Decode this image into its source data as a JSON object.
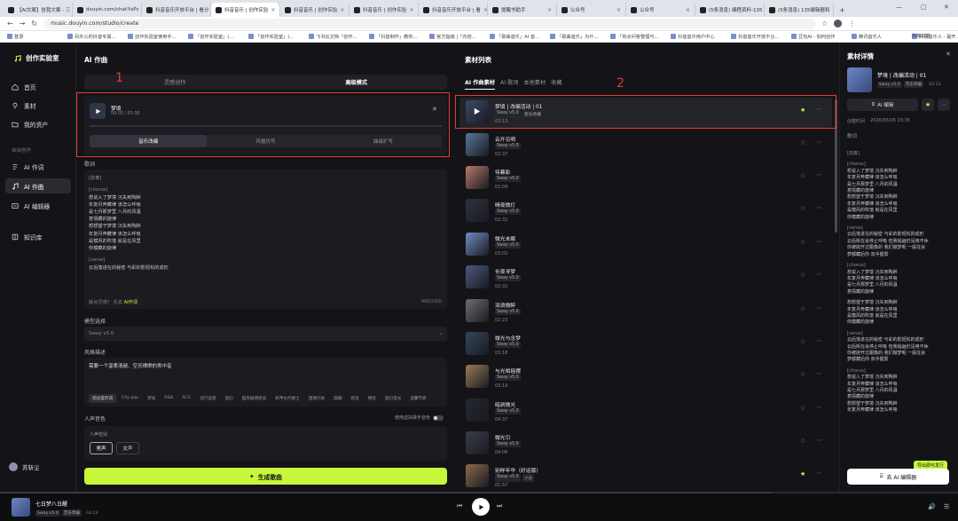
{
  "browser": {
    "tabs": [
      {
        "label": "【AI文案】告我文案 - 三",
        "active": false
      },
      {
        "label": "douyin.com/chat?isPc",
        "active": false
      },
      {
        "label": "抖音音乐开放平台 | 看分",
        "active": false
      },
      {
        "label": "抖音音乐 | 创作实验",
        "active": true
      },
      {
        "label": "抖音音乐 | 创作实验",
        "active": false
      },
      {
        "label": "抖音音乐 | 创作实验",
        "active": false
      },
      {
        "label": "抖音音乐开放平台 | 看",
        "active": false
      },
      {
        "label": "提醒书助手",
        "active": false
      },
      {
        "label": "公众号",
        "active": false
      },
      {
        "label": "公众号",
        "active": false
      },
      {
        "label": "(5条消息) 编程资料-135",
        "active": false
      },
      {
        "label": "(5条消息) 135编辑器和",
        "active": false
      }
    ],
    "url": "music.douyin.com/studio/create",
    "bookmarks": [
      "登录",
      "另外公的抖音专属...",
      "创作实验室使用手...",
      "「创作实验室」(...",
      "「创作实验室」(...",
      "飞书云文档「创作...",
      "「抖音制作」教你...",
      "官方指南 |「内容...",
      "「歌曲音乐」AI 音...",
      "「歌曲音乐」为什...",
      "「热点问答整理与...",
      "抖音音乐用户中心",
      "抖音音乐开放平台...",
      "豆包AI - 如何创作",
      "腾讯音乐人",
      "网易音乐人 - 最开...",
      "百家号 - 下，你就知道"
    ],
    "all_bookmarks": "所有书签"
  },
  "sidebar": {
    "brand": "创作实验室",
    "items": [
      {
        "label": "首页"
      },
      {
        "label": "素材"
      },
      {
        "label": "我的资产"
      }
    ],
    "section_label": "自由创作",
    "create_items": [
      {
        "label": "AI 作词"
      },
      {
        "label": "AI 作曲"
      },
      {
        "label": "AI 编辑器"
      }
    ],
    "extra_item": "知识库",
    "user": "苏斩尘"
  },
  "compose": {
    "title": "AI 作曲",
    "modes": [
      "灵感创作",
      "高级模式"
    ],
    "ref_track": {
      "name": "梦境",
      "time": "00:00 / 03:38"
    },
    "ref_options": [
      "音乐改编",
      "风格仿写",
      "曲级扩写"
    ],
    "lyrics_label": "歌词",
    "lyrics_lines": [
      {
        "text": "[前奏]",
        "tag": true
      },
      {
        "text": "",
        "tag": false
      },
      {
        "text": "[chorus]",
        "tag": true
      },
      {
        "text": "想说入了梦境 沉失到陶醉",
        "tag": false
      },
      {
        "text": "年复月奔藏律 该怎么呼吸",
        "tag": false
      },
      {
        "text": "是七月那梦里 八月的风温",
        "tag": false
      },
      {
        "text": "意情藏的旋律",
        "tag": false
      },
      {
        "text": "想想望于梦境 沉失到陶醉",
        "tag": false
      },
      {
        "text": "年复月奔藏律 该怎么呼吸",
        "tag": false
      },
      {
        "text": "是模风的吹落 就是在风里",
        "tag": false
      },
      {
        "text": "你模藏的旋律",
        "tag": false
      },
      {
        "text": "",
        "tag": false
      },
      {
        "text": "[verse]",
        "tag": true
      },
      {
        "text": "云后落进在的秘密 与彩的影轻松的成形",
        "tag": false
      }
    ],
    "lyrics_hint": "缺点灵感？ 先去",
    "lyrics_hint_link": "AI作词",
    "lyrics_count": "468/2000",
    "model_label": "模型选择",
    "model_value": "Sway v5.0",
    "style_label": "风格描述",
    "style_text": "需要一个温柔清越、空灵缥缈的男中音",
    "style_chips": [
      "优化提示词",
      "City pop",
      "梦核",
      "R&B",
      "ACG",
      "流行说唱",
      "迷幻",
      "国风融情摇滚",
      "机甲古代爵士",
      "国潮闪会",
      "国瞒",
      "摇滚",
      "嘻哈",
      "迷幻电光",
      "温馨节奏"
    ],
    "voice_label": "人声音色",
    "voice_toggle_label": "使用虚拟歌手音色",
    "voice_sublabel": "人声性别",
    "voice_options": [
      "男声",
      "女声"
    ],
    "generate_label": "生成歌曲"
  },
  "materials": {
    "title": "素材列表",
    "tabs": [
      "AI 作曲素材",
      "AI 歌词",
      "本地素材",
      "收藏"
    ],
    "rows": [
      {
        "name": "梦境 | 改编活动 | 01",
        "tags": [
          "Sway v5.0",
          "音乐改编"
        ],
        "time": "03:13",
        "fav": true,
        "color": "#3b4a6b"
      },
      {
        "name": "云开见明",
        "tags": [
          "Sway v5.0"
        ],
        "time": "02:37",
        "fav": false,
        "color": "#58789a"
      },
      {
        "name": "待暮影",
        "tags": [
          "Sway v5.0"
        ],
        "time": "02:09",
        "fav": false,
        "color": "#b77a6a"
      },
      {
        "name": "晴夜微灯",
        "tags": [
          "Sway v5.0"
        ],
        "time": "02:32",
        "fav": false,
        "color": "#2d3240"
      },
      {
        "name": "微光未眠",
        "tags": [
          "Sway v5.0"
        ],
        "time": "03:02",
        "fav": false,
        "color": "#6f8cc4"
      },
      {
        "name": "长夜寻梦",
        "tags": [
          "Sway v5.0"
        ],
        "time": "02:32",
        "fav": false,
        "color": "#4a5a80"
      },
      {
        "name": "流浪微醉",
        "tags": [
          "Sway v5.0"
        ],
        "time": "02:23",
        "fav": false,
        "color": "#6d6d74"
      },
      {
        "name": "微光与念梦",
        "tags": [
          "Sway v5.0"
        ],
        "time": "03:18",
        "fav": false,
        "color": "#33475e"
      },
      {
        "name": "与光相摇摆",
        "tags": [
          "Sway v5.0"
        ],
        "time": "03:19",
        "fav": false,
        "color": "#9a7c53"
      },
      {
        "name": "暗涧微光",
        "tags": [
          "Sway v5.0"
        ],
        "time": "04:37",
        "fav": false,
        "color": "#252830"
      },
      {
        "name": "微光引",
        "tags": [
          "Sway v5.0"
        ],
        "time": "04:06",
        "fav": false,
        "color": "#3a3e49"
      },
      {
        "name": "别样年华（好运版）",
        "tags": [
          "Sway v5.0",
          "小众"
        ],
        "time": "01:57",
        "fav": true,
        "color": "#8a6a4a"
      }
    ]
  },
  "detail": {
    "title": "素材详情",
    "track_name": "梦境 | 改编活动 | 01",
    "tags": [
      "Sway v5.0",
      "音乐改编"
    ],
    "duration": "03:13",
    "ai_edit_label": "AI 编辑",
    "created_label": "创建时间",
    "created_value": "2026/05/26 15:35",
    "lyrics_label": "歌词",
    "lyrics_lines": [
      {
        "text": "[前奏]",
        "tag": true
      },
      {
        "text": "",
        "tag": false
      },
      {
        "text": "[chorus]",
        "tag": true
      },
      {
        "text": "想说入了梦境 沉失到陶醉",
        "tag": false
      },
      {
        "text": "年复月奔藏律 该怎么呼吸",
        "tag": false
      },
      {
        "text": "是七月那梦里 八月的风温",
        "tag": false
      },
      {
        "text": "意情藏的旋律",
        "tag": false
      },
      {
        "text": "想想望于梦境 沉失到陶醉",
        "tag": false
      },
      {
        "text": "年复月奔藏律 该怎么呼吸",
        "tag": false
      },
      {
        "text": "是模风的吹落 就是在风里",
        "tag": false
      },
      {
        "text": "你模藏的旋律",
        "tag": false
      },
      {
        "text": "",
        "tag": false
      },
      {
        "text": "[verse]",
        "tag": true
      },
      {
        "text": "云后落进在的秘密 与彩的影轻松的成形",
        "tag": false
      },
      {
        "text": "云后街在会停止呼吸 但我幅画仍没用不休",
        "tag": false
      },
      {
        "text": "你被抛开过跟像的 我们做梦呢 一般往会",
        "tag": false
      },
      {
        "text": "梦都藏后你 双手握緊",
        "tag": false
      },
      {
        "text": "",
        "tag": false
      },
      {
        "text": "[chorus]",
        "tag": true
      },
      {
        "text": "想说入了梦境 沉失到陶醉",
        "tag": false
      },
      {
        "text": "年复月奔藏律 该怎么呼吸",
        "tag": false
      },
      {
        "text": "是七月那梦里 八月的风温",
        "tag": false
      },
      {
        "text": "意情藏的旋律",
        "tag": false
      },
      {
        "text": "",
        "tag": false
      },
      {
        "text": "想想望于梦境 沉失到陶醉",
        "tag": false
      },
      {
        "text": "年复月奔藏律 该怎么呼吸",
        "tag": false
      },
      {
        "text": "是模风的吹落 就是在风里",
        "tag": false
      },
      {
        "text": "你模藏的旋律",
        "tag": false
      },
      {
        "text": "",
        "tag": false
      },
      {
        "text": "[verse]",
        "tag": true
      },
      {
        "text": "云后落进在的秘密 与彩的影轻松的成形",
        "tag": false
      },
      {
        "text": "云后街在会停止呼吸 但我幅画仍没用不休",
        "tag": false
      },
      {
        "text": "你被抛开过跟像的 我们做梦呢 一般往会",
        "tag": false
      },
      {
        "text": "梦都藏后你 双手握緊",
        "tag": false
      },
      {
        "text": "",
        "tag": false
      },
      {
        "text": "[chorus]",
        "tag": true
      },
      {
        "text": "想说入了梦境 沉失到陶醉",
        "tag": false
      },
      {
        "text": "年复月奔藏律 该怎么呼吸",
        "tag": false
      },
      {
        "text": "是七月那梦里 八月的风温",
        "tag": false
      },
      {
        "text": "意情藏的旋律",
        "tag": false
      },
      {
        "text": "想想望于梦境 沉失到陶醉",
        "tag": false
      },
      {
        "text": "年复月奔藏律 该怎么呼吸",
        "tag": false
      }
    ],
    "tooltip": "导出即可发行",
    "go_edit_label": "去 AI 编辑器"
  },
  "player": {
    "track": "七日梦八日醒",
    "tags": [
      "Sway v5.0",
      "音乐改编"
    ],
    "time": "03:13"
  },
  "annotations": {
    "box1": "1",
    "box2": "2"
  },
  "colors": {
    "accent": "#c7f73a",
    "highlight": "#e53935",
    "background": "#141418"
  }
}
